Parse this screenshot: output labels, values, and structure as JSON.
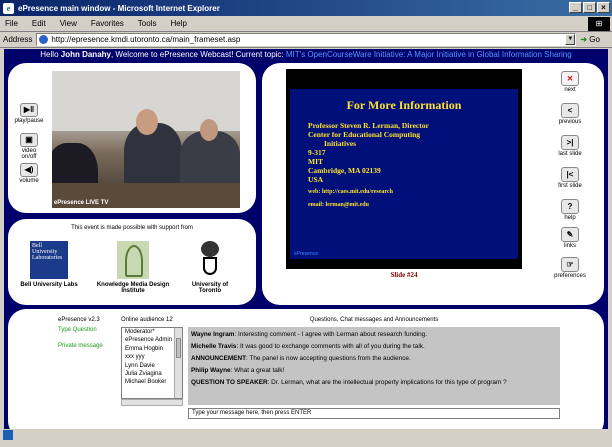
{
  "window": {
    "title": "ePresence main window - Microsoft Internet Explorer",
    "logo": "e",
    "controls": [
      "_",
      "□",
      "×"
    ]
  },
  "menu": [
    "File",
    "Edit",
    "View",
    "Favorites",
    "Tools",
    "Help"
  ],
  "address": {
    "label": "Address",
    "url": "http://epresence.kmdi.utoronto.ca/main_frameset.asp",
    "go": "Go"
  },
  "welcome": {
    "hello": "Hello",
    "user": "John Danahy",
    "middle": ", Welcome to ePresence Webcast! Current topic:",
    "topic": "MIT's OpenCourseWare Initiative: A Major Initiative in Global Information Sharing"
  },
  "video_controls": [
    "play/pause",
    "video on/off",
    "volume"
  ],
  "video_logo": "ePresence LIVE TV",
  "sponsors": {
    "title": "This event is made possible with support from",
    "items": [
      {
        "name": "Bell University Labs",
        "logo_text": "Bell University Laboratories"
      },
      {
        "name": "Knowledge Media Design Institute"
      },
      {
        "name": "University of Toronto"
      }
    ]
  },
  "slide": {
    "title": "For More Information",
    "lines": [
      "Professor Steven R. Lerman, Director",
      "Center for Educational Computing",
      "Initiatives",
      "9-317",
      "MIT",
      "Cambridge, MA 02139",
      "USA",
      "web: http://caes.mit.edu/research",
      "email: lerman@mit.edu"
    ],
    "corner": "ePresence",
    "number": "Slide #24"
  },
  "nav": [
    "next",
    "previous",
    "last slide",
    "first slide",
    "help",
    "links",
    "preferences"
  ],
  "chat": {
    "version": "ePresence v2.3",
    "type_question": "Type Question",
    "private_message": "Private message",
    "audience_title": "Online audience 12",
    "audience": [
      "Moderator*",
      "ePresence Admin",
      "Emma Hogbin",
      "xxx yyy",
      "Lynn Davie",
      "Julia Zviagina",
      "Michael Booker"
    ],
    "log_title": "Questions, Chat messages and Announcements",
    "messages": [
      {
        "who": "Wayne Ingram",
        "text": ": Interesting comment - I agree with Lerman about research funding."
      },
      {
        "who": "Michelle Travis",
        "text": ":  It was good to exchange comments with all of you during the talk."
      },
      {
        "who": "ANNOUNCEMENT",
        "text": ":  The panel is now accepting questions from the audience."
      },
      {
        "who": "Philip Wayne",
        "text": ":  What a great talk!"
      },
      {
        "who": "QUESTION TO SPEAKER",
        "text": ":  Dr. Lerman, what are the intellectual property implications for this type of program ?"
      }
    ],
    "input_placeholder": "Type your message here, then press ENTER"
  }
}
